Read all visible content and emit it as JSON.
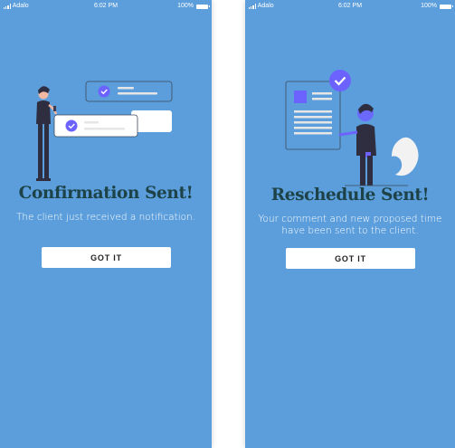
{
  "screens": [
    {
      "status": {
        "carrier": "Adalo",
        "time": "6:02 PM",
        "battery": "100%"
      },
      "title": "Confirmation Sent!",
      "message": "The client just received a notification.",
      "button_label": "GOT IT"
    },
    {
      "status": {
        "carrier": "Adalo",
        "time": "6:02 PM",
        "battery": "100%"
      },
      "title": "Reschedule Sent!",
      "message": "Your comment and new proposed time have been sent to the client.",
      "button_label": "GOT IT"
    }
  ],
  "colors": {
    "background": "#5b9edb",
    "title": "#1d4247",
    "accent_purple": "#6c63ff",
    "button_bg": "#ffffff"
  }
}
